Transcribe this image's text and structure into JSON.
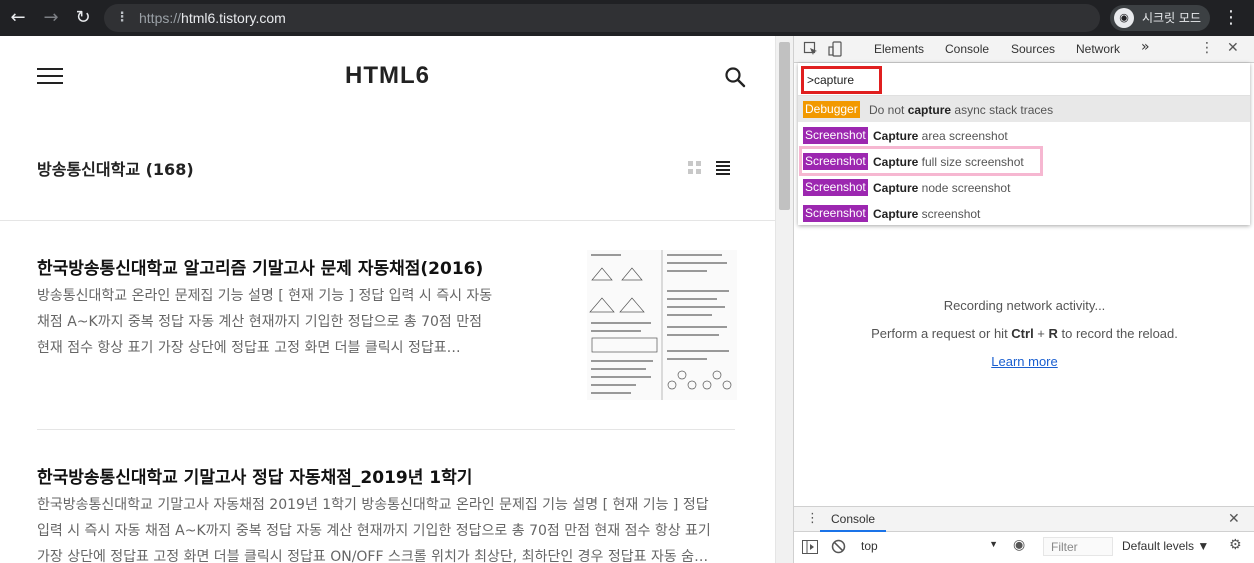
{
  "browser": {
    "url_scheme": "https://",
    "url_host": "html6.tistory.com",
    "incognito_label": "시크릿 모드",
    "icons": [
      "back-icon",
      "forward-icon",
      "reload-icon",
      "site-info-icon",
      "incognito-icon",
      "menu-dots-icon"
    ]
  },
  "page": {
    "site_title": "HTML6",
    "category_title": "방송통신대학교 (168)",
    "posts": [
      {
        "title": "한국방송통신대학교 알고리즘 기말고사 문제 자동채점(2016)",
        "excerpt": [
          "방송통신대학교 온라인 문제집 기능 설명 [ 현재 기능 ] 정답 입력 시 즉시 자동",
          "채점 A~K까지 중복 정답 자동 계산 현재까지 기입한 정답으로 총 70점 만점",
          "현재 점수 항상 표기 가장 상단에 정답표 고정 화면 더블 클릭시 정답표…"
        ]
      },
      {
        "title": "한국방송통신대학교 기말고사 정답 자동채점_2019년 1학기",
        "excerpt": [
          "한국방송통신대학교 기말고사 자동채점 2019년 1학기 방송통신대학교 온라인 문제집 기능 설명 [ 현재 기능 ] 정답",
          "입력 시 즉시 자동 채점 A~K까지 중복 정답 자동 계산 현재까지 기입한 정답으로 총 70점 만점 현재 점수 항상 표기",
          "가장 상단에 정답표 고정 화면 더블 클릭시 정답표 ON/OFF 스크롤 위치가 최상단, 최하단인 경우 정답표 자동 숨…"
        ]
      }
    ]
  },
  "devtools": {
    "tabs": [
      "Elements",
      "Console",
      "Sources",
      "Network"
    ],
    "more_tabs": "»",
    "command_input": ">capture",
    "commands": [
      {
        "badge": "Debugger",
        "badge_type": "debugger",
        "pre": "Do not ",
        "bold": "capture",
        "post": " async stack traces"
      },
      {
        "badge": "Screenshot",
        "badge_type": "screenshot",
        "pre": "",
        "bold": "Capture",
        "post": " area screenshot"
      },
      {
        "badge": "Screenshot",
        "badge_type": "screenshot",
        "pre": "",
        "bold": "Capture",
        "post": " full size screenshot"
      },
      {
        "badge": "Screenshot",
        "badge_type": "screenshot",
        "pre": "",
        "bold": "Capture",
        "post": " node screenshot"
      },
      {
        "badge": "Screenshot",
        "badge_type": "screenshot",
        "pre": "",
        "bold": "Capture",
        "post": " screenshot"
      }
    ],
    "network": {
      "recording": "Recording network activity...",
      "hint_pre": "Perform a request or hit ",
      "hint_key1": "Ctrl",
      "hint_plus": " + ",
      "hint_key2": "R",
      "hint_post": " to record the reload.",
      "learn_more": "Learn more"
    },
    "drawer": {
      "tab": "Console",
      "context": "top",
      "filter_placeholder": "Filter",
      "levels": "Default levels ▼"
    }
  },
  "colors": {
    "chrome_dark": "#202124",
    "highlight_red": "#e01f1f",
    "highlight_pink": "#f6b7d1",
    "badge_debugger": "#f29900",
    "badge_screenshot": "#9c27b0",
    "link_blue": "#1a5fd0"
  }
}
